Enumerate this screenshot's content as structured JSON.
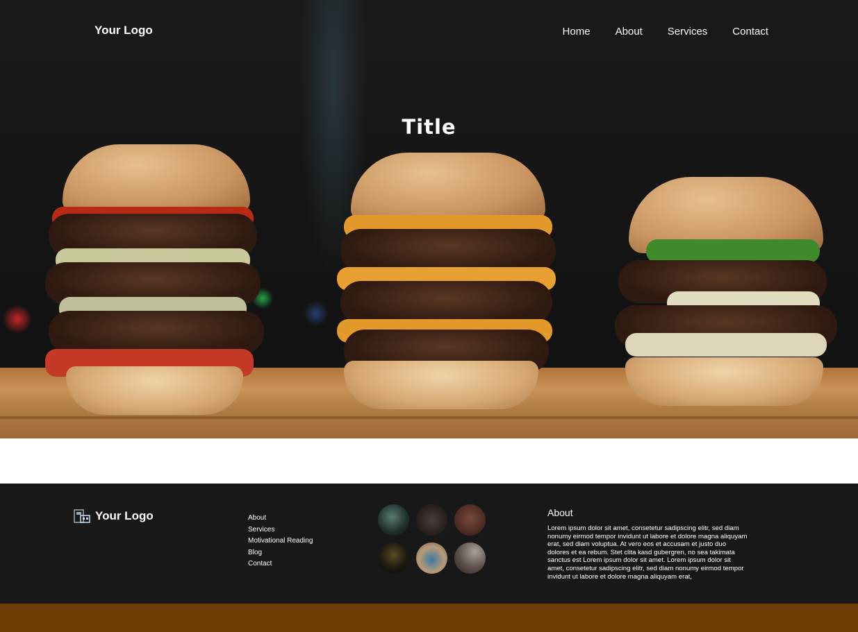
{
  "header": {
    "logo": "Your Logo",
    "nav": [
      "Home",
      "About",
      "Services",
      "Contact"
    ]
  },
  "hero": {
    "title": "Title"
  },
  "footer": {
    "logo": "Your Logo",
    "links": [
      "About",
      "Services",
      "Motivational Reading",
      "Blog",
      "Contact"
    ],
    "about_title": "About",
    "about_text": "Lorem ipsum dolor sit amet, consetetur sadipscing elitr, sed diam nonumy eirmod tempor invidunt ut labore et dolore magna aliquyam erat, sed diam voluptua. At vero eos et accusam et justo duo dolores et ea rebum. Stet clita kasd gubergren, no sea takimata sanctus est Lorem ipsum dolor sit amet. Lorem ipsum dolor sit amet, consetetur sadipscing elitr, sed diam nonumy eirmod tempor invidunt ut labore et dolore magna aliquyam erat,"
  },
  "colors": {
    "footer_bg": "#181818",
    "bottom_bar": "#6c3a02",
    "text": "#ffffff"
  }
}
